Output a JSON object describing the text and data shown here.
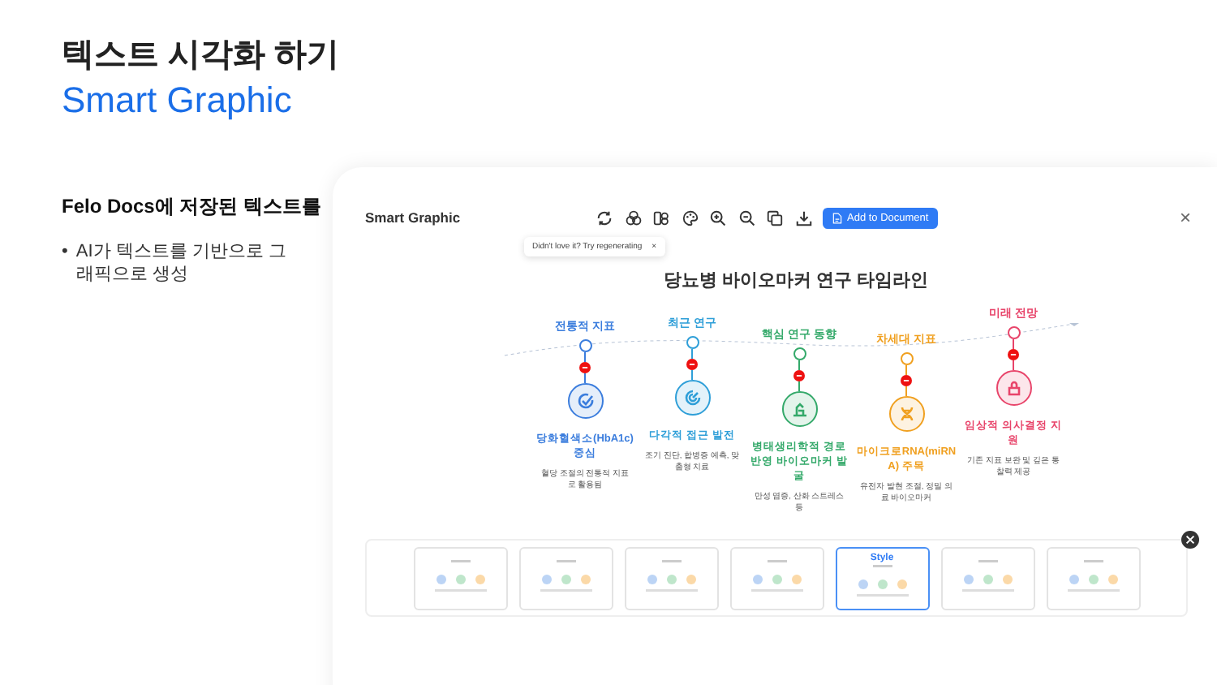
{
  "heading": {
    "title": "텍스트 시각화 하기",
    "subtitle": "Smart Graphic"
  },
  "intro": {
    "lead": "Felo Docs에 저장된 텍스트를",
    "bullets": [
      {
        "marker": "•",
        "text": "AI가 텍스트를 기반으로 그래픽으로 생성"
      }
    ]
  },
  "panel": {
    "title": "Smart Graphic",
    "primary_button": "Add to Document",
    "tooltip": {
      "text": "Didn't love it? Try regenerating",
      "close": "×"
    },
    "close": "×",
    "graphic": {
      "title": "당뇨병 바이오마커 연구 타임라인",
      "milestones": [
        {
          "label": "전통적 지표",
          "title": "당화혈색소(HbA1c) 중심",
          "desc": "혈당 조절의 전통적 지표로 활용됨",
          "color": "#3b7ddd"
        },
        {
          "label": "최근 연구",
          "title": "다각적 접근 발전",
          "desc": "조기 진단, 합병증 예측, 맞춤형 치료",
          "color": "#2f9fd8"
        },
        {
          "label": "핵심 연구 동향",
          "title": "병태생리학적 경로 반영 바이오마커 발굴",
          "desc": "만성 염증, 산화 스트레스 등",
          "color": "#34a96a"
        },
        {
          "label": "차세대 지표",
          "title": "마이크로RNA(miRNA) 주목",
          "desc": "유전자 발현 조절, 정밀 의료 바이오마커",
          "color": "#f0a020"
        },
        {
          "label": "미래 전망",
          "title": "임상적 의사결정 지원",
          "desc": "기존 지표 보완 및 깊은 통찰력 제공",
          "color": "#e8446a"
        }
      ]
    },
    "styles": {
      "selected_label": "Style",
      "items": [
        {
          "selected": false
        },
        {
          "selected": false
        },
        {
          "selected": false
        },
        {
          "selected": false
        },
        {
          "selected": true
        },
        {
          "selected": false
        },
        {
          "selected": false
        }
      ]
    }
  }
}
